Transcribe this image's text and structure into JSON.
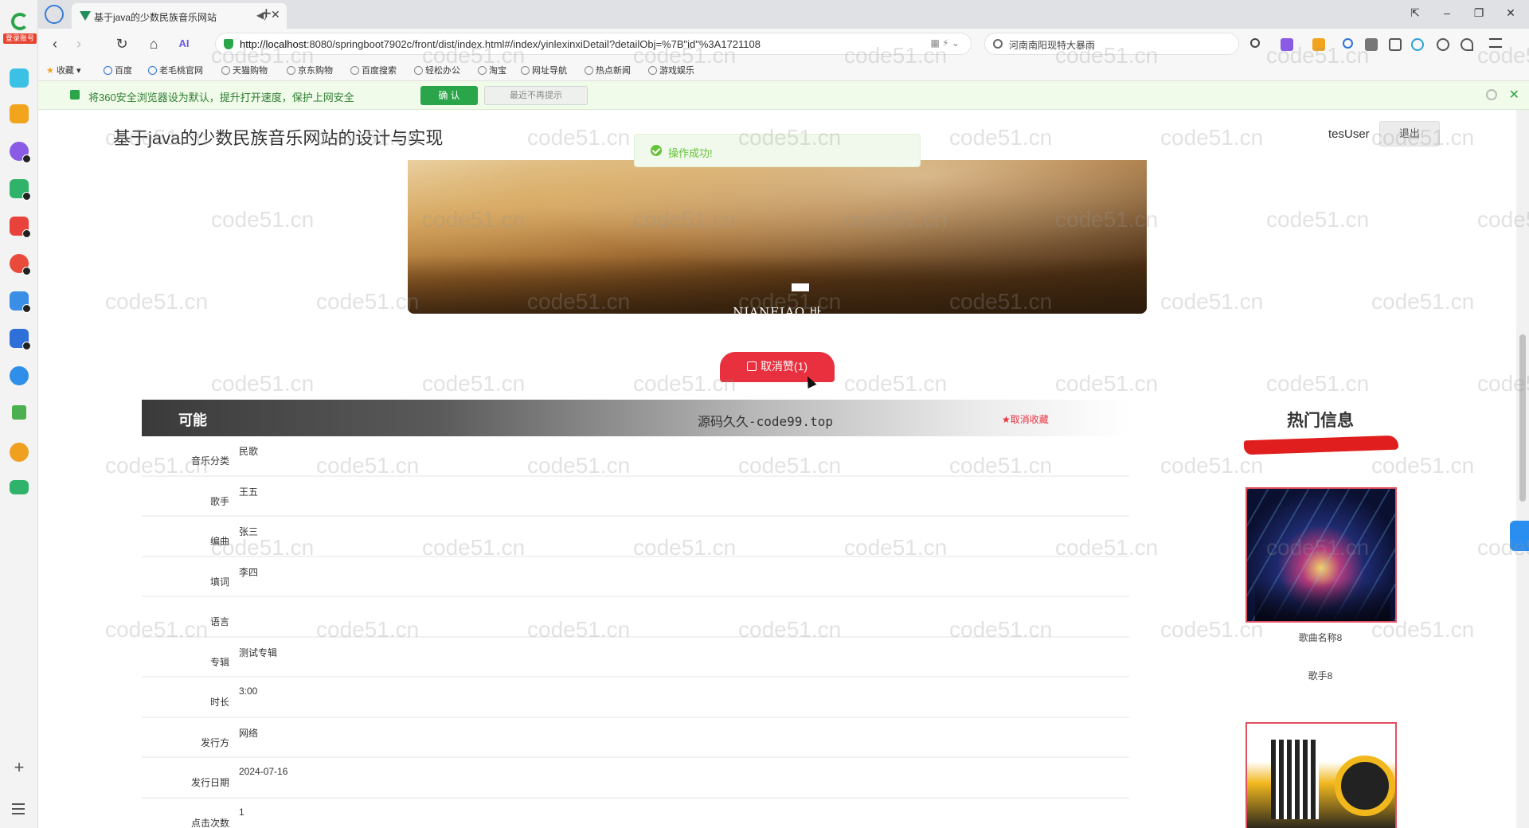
{
  "browser": {
    "brand_tag": "登录账号",
    "tab_title": "基于java的少数民族音乐网站",
    "url_host": "http://localhost",
    "url_rest": ":8080/springboot7902c/front/dist/index.html#/index/yinlexinxiDetail?detailObj=%7B\"id\"%3A1721108",
    "search_text": "河南南阳现特大暴雨",
    "bookmarks": [
      "收藏",
      "百度",
      "老毛桃官网",
      "天猫购物",
      "京东购物",
      "百度搜索",
      "轻松办公",
      "淘宝",
      "网址导航",
      "热点新闻",
      "游戏娱乐"
    ],
    "notice_text": "将360安全浏览器设为默认，提升打开速度，保护上网安全",
    "notice_ok": "确 认",
    "notice_later": "最近不再提示"
  },
  "header": {
    "site_title": "基于java的少数民族音乐网站的设计与实现",
    "user": "tesUser",
    "logout": "退出"
  },
  "toast": {
    "text": "操作成功!"
  },
  "banner": {
    "caption": "NIANEIAO 바"
  },
  "like": {
    "label": "取消赞(1)"
  },
  "detail": {
    "name": "可能",
    "mid_text": "源码久久-code99.top",
    "fav_label": "★取消收藏",
    "rows": [
      {
        "label": "音乐分类",
        "value": "民歌"
      },
      {
        "label": "歌手",
        "value": "王五"
      },
      {
        "label": "编曲",
        "value": "张三"
      },
      {
        "label": "填词",
        "value": "李四"
      },
      {
        "label": "语言",
        "value": ""
      },
      {
        "label": "专辑",
        "value": "测试专辑"
      },
      {
        "label": "时长",
        "value": "3:00"
      },
      {
        "label": "发行方",
        "value": "网络"
      },
      {
        "label": "发行日期",
        "value": "2024-07-16"
      },
      {
        "label": "点击次数",
        "value": "1"
      }
    ]
  },
  "hot": {
    "title": "热门信息",
    "items": [
      {
        "name": "歌曲名称8",
        "singer": "歌手8"
      }
    ]
  },
  "watermark": "code51.cn",
  "colors": {
    "accent_red": "#e8303e",
    "success_green": "#67c23a",
    "browser_green": "#2aa549"
  }
}
